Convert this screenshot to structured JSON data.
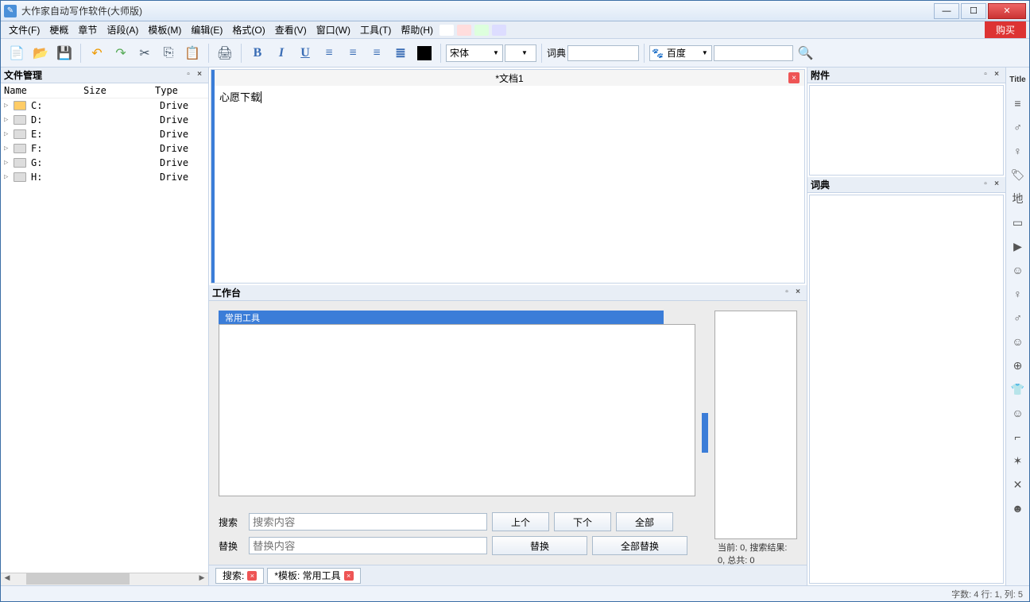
{
  "app_title": "大作家自动写作软件(大师版)",
  "buy_label": "购买",
  "menu": [
    "文件(F)",
    "梗概",
    "章节",
    "语段(A)",
    "模板(M)",
    "编辑(E)",
    "格式(O)",
    "查看(V)",
    "窗口(W)",
    "工具(T)",
    "帮助(H)"
  ],
  "toolbar": {
    "font_name": "宋体",
    "dict_label": "词典",
    "search_engine": "百度"
  },
  "file_panel": {
    "title": "文件管理",
    "headers": {
      "name": "Name",
      "size": "Size",
      "type": "Type"
    },
    "drives": [
      {
        "name": "C:",
        "type": "Drive",
        "kind": "c"
      },
      {
        "name": "D:",
        "type": "Drive",
        "kind": "d"
      },
      {
        "name": "E:",
        "type": "Drive",
        "kind": "d"
      },
      {
        "name": "F:",
        "type": "Drive",
        "kind": "d"
      },
      {
        "name": "G:",
        "type": "Drive",
        "kind": "d"
      },
      {
        "name": "H:",
        "type": "Drive",
        "kind": "d"
      }
    ]
  },
  "document": {
    "tab_title": "*文档1",
    "content": "心愿下载"
  },
  "attachment_panel": {
    "title": "附件"
  },
  "dict_panel": {
    "title": "词典"
  },
  "workspace": {
    "title": "工作台",
    "tab": "常用工具",
    "search_label": "搜索",
    "search_placeholder": "搜索内容",
    "replace_label": "替换",
    "replace_placeholder": "替换内容",
    "btn_prev": "上个",
    "btn_next": "下个",
    "btn_all": "全部",
    "btn_replace": "替换",
    "btn_replace_all": "全部替换",
    "status": "当前: 0, 搜索结果: 0, 总共: 0"
  },
  "bottom_tabs": {
    "search_tab": "搜索:",
    "template_tab": "*模板: 常用工具"
  },
  "status_bar": "字数: 4 行: 1, 列: 5",
  "sidebar_items": [
    "Title",
    "≡",
    "♂",
    "♀",
    "🏷",
    "地",
    "▭",
    "▶",
    "☺",
    "♀",
    "♂",
    "☺",
    "⊕",
    "👕",
    "☺",
    "⌐",
    "✶",
    "✕",
    "☻"
  ]
}
